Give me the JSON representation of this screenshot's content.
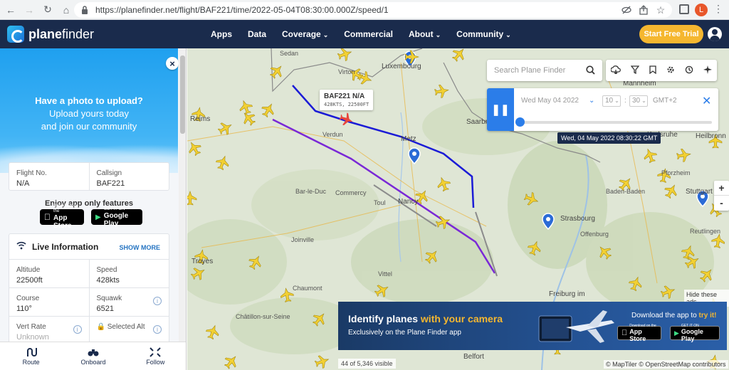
{
  "browser": {
    "url": "https://planefinder.net/flight/BAF221/time/2022-05-04T08:30:00.000Z/speed/1",
    "profile_initial": "L"
  },
  "site": {
    "logo_part1": "plane",
    "logo_part2": "finder",
    "nav": [
      {
        "label": "Apps",
        "has_dropdown": false
      },
      {
        "label": "Data",
        "has_dropdown": false
      },
      {
        "label": "Coverage",
        "has_dropdown": true
      },
      {
        "label": "Commercial",
        "has_dropdown": false
      },
      {
        "label": "About",
        "has_dropdown": true
      },
      {
        "label": "Community",
        "has_dropdown": true
      }
    ],
    "trial_button": "Start Free Trial"
  },
  "panel": {
    "promo": {
      "title": "Have a photo to upload?",
      "line1": "Upload yours today",
      "line2": "and join our community"
    },
    "flight_no_label": "Flight No.",
    "flight_no_value": "N/A",
    "callsign_label": "Callsign",
    "callsign_value": "BAF221",
    "enjoy_text": "Enjoy app only features",
    "appstore": {
      "small": "Download on the",
      "big": "App Store"
    },
    "googleplay": {
      "small": "GET IT ON",
      "big": "Google Play"
    },
    "live": {
      "title": "Live Information",
      "show_more": "SHOW MORE",
      "altitude_label": "Altitude",
      "altitude_value": "22500ft",
      "speed_label": "Speed",
      "speed_value": "428kts",
      "course_label": "Course",
      "course_value": "110°",
      "squawk_label": "Squawk",
      "squawk_value": "6521",
      "vert_label": "Vert Rate",
      "vert_value": "Unknown",
      "selalt_label": "Selected Alt"
    },
    "bottom": [
      {
        "label": "Route",
        "icon": "route-icon"
      },
      {
        "label": "Onboard",
        "icon": "binoculars-icon"
      },
      {
        "label": "Follow",
        "icon": "follow-icon"
      }
    ]
  },
  "map": {
    "search_placeholder": "Search Plane Finder",
    "date_value": "Wed May 04 2022",
    "hour": "10",
    "minute": "30",
    "timezone": "GMT+2",
    "timestamp": "Wed, 04 May 2022 08:30:22 GMT",
    "flight_callsign": "BAF221 N/A",
    "flight_info": "428KTS, 22500FT",
    "zoom_in": "+",
    "zoom_out": "-",
    "hide_ads": "Hide these ads",
    "visible_count": "44 of 5,346 visible",
    "attribution": "© MapTiler © OpenStreetMap contributors",
    "places": [
      {
        "name": "Sedan",
        "big": false
      },
      {
        "name": "Virton",
        "big": false
      },
      {
        "name": "Luxembourg",
        "big": true
      },
      {
        "name": "Reims",
        "big": true
      },
      {
        "name": "Verdun",
        "big": false
      },
      {
        "name": "Metz",
        "big": true
      },
      {
        "name": "Saarbrü",
        "big": true
      },
      {
        "name": "Mannheim",
        "big": true
      },
      {
        "name": "Heilbronn",
        "big": true
      },
      {
        "name": "Karlsruhe",
        "big": true
      },
      {
        "name": "Pforzheim",
        "big": false
      },
      {
        "name": "Bar-le-Duc",
        "big": false
      },
      {
        "name": "Commercy",
        "big": false
      },
      {
        "name": "Toul",
        "big": false
      },
      {
        "name": "Nancy",
        "big": true
      },
      {
        "name": "Baden-Baden",
        "big": false
      },
      {
        "name": "Stuttgart",
        "big": true
      },
      {
        "name": "Strasbourg",
        "big": true
      },
      {
        "name": "Reutlingen",
        "big": false
      },
      {
        "name": "Offenburg",
        "big": false
      },
      {
        "name": "Troyes",
        "big": true
      },
      {
        "name": "Joinville",
        "big": false
      },
      {
        "name": "Chaumont",
        "big": false
      },
      {
        "name": "Vittel",
        "big": false
      },
      {
        "name": "Freiburg im",
        "big": true
      },
      {
        "name": "Châtillon-sur-Seine",
        "big": false
      },
      {
        "name": "Belfort",
        "big": true
      }
    ]
  },
  "ad": {
    "headline_a": "Identify planes ",
    "headline_b": "with your camera",
    "subline": "Exclusively on the Plane Finder app",
    "download_a": "Download the app to ",
    "download_b": "try it!",
    "appstore": {
      "small": "Download on the",
      "big": "App Store"
    },
    "googleplay": {
      "small": "GET IT ON",
      "big": "Google Play"
    }
  },
  "colors": {
    "header_bg": "#1a2b4c",
    "accent": "#f5b730",
    "route_blue": "#1b1bd6",
    "route_purple": "#7a28d6",
    "playback_blue": "#2b7de9"
  }
}
